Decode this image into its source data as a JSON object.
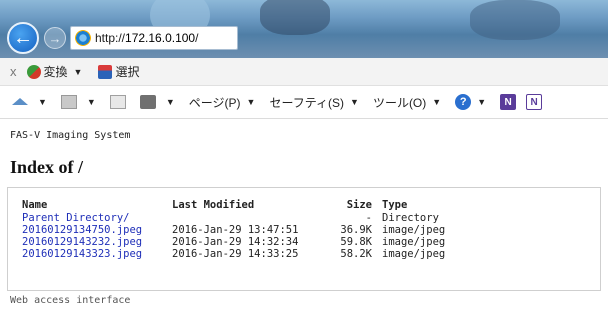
{
  "browser": {
    "url_prefix": "http://",
    "url_host": "172.16.0.100",
    "url_suffix": "/"
  },
  "translate_bar": {
    "close": "x",
    "convert_label": "変換",
    "select_label": "選択"
  },
  "command_bar": {
    "page_menu": "ページ(P)",
    "safety_menu": "セーフティ(S)",
    "tools_menu": "ツール(O)"
  },
  "page": {
    "system_name": "FAS-V Imaging System",
    "heading": "Index of /",
    "footer": "Web access interface"
  },
  "listing": {
    "columns": [
      "Name",
      "Last Modified",
      "Size",
      "Type"
    ],
    "rows": [
      {
        "name": "Parent Directory/",
        "modified": "",
        "size": "-",
        "type": "Directory"
      },
      {
        "name": "20160129134750.jpeg",
        "modified": "2016-Jan-29 13:47:51",
        "size": "36.9K",
        "type": "image/jpeg"
      },
      {
        "name": "20160129143232.jpeg",
        "modified": "2016-Jan-29 14:32:34",
        "size": "59.8K",
        "type": "image/jpeg"
      },
      {
        "name": "20160129143323.jpeg",
        "modified": "2016-Jan-29 14:33:25",
        "size": "58.2K",
        "type": "image/jpeg"
      }
    ]
  }
}
